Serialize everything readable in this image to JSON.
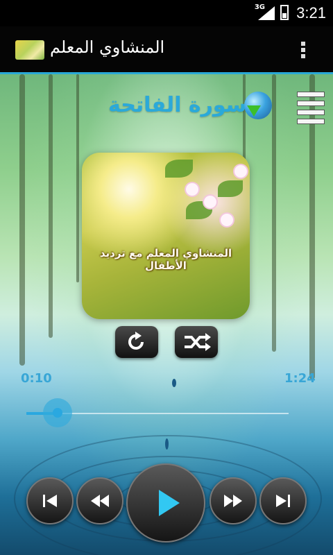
{
  "status_bar": {
    "network": "3G",
    "time": "3:21"
  },
  "app_bar": {
    "title": "المنشاوي المعلم"
  },
  "player": {
    "surah_title": "سورة الفاتحة",
    "artwork_caption": "المنشاوي المعلم مع ترديد الأطفال",
    "elapsed": "0:10",
    "duration": "1:24",
    "progress": 0.12
  },
  "icons": {
    "overflow": "overflow-menu-icon",
    "download": "globe-download-icon",
    "playlist": "playlist-menu-icon",
    "repeat": "repeat-icon",
    "shuffle": "shuffle-icon",
    "skip_previous": "skip-previous-icon",
    "rewind": "rewind-icon",
    "play": "play-icon",
    "fast_forward": "fast-forward-icon",
    "skip_next": "skip-next-icon"
  },
  "colors": {
    "accent": "#2aa8e0",
    "surah_title": "#2ba9d9"
  }
}
